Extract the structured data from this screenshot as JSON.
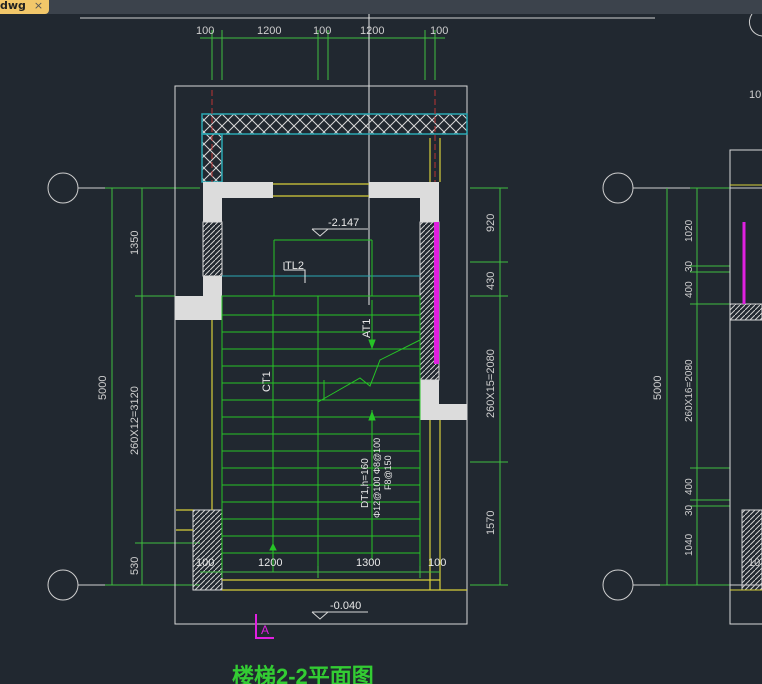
{
  "tab": {
    "label": "dwg",
    "close": "×"
  },
  "drawing": {
    "title": "楼梯2-2平面图",
    "section_mark": "A",
    "levels": {
      "upper": "-2.147",
      "lower": "-0.040"
    },
    "top_dims": [
      "100",
      "1200",
      "100",
      "1200",
      "100"
    ],
    "bottom_dims": [
      "100",
      "1200",
      "1300",
      "100"
    ],
    "left_dims": {
      "total": "5000",
      "upper": "1350",
      "middle": "260X12=3120",
      "lower": "530"
    },
    "right_dims": {
      "d1": "920",
      "d2": "430",
      "d3": "260X15=2080",
      "d4": "1570"
    },
    "labels": {
      "tl": "TL2",
      "ct": "CT1",
      "at": "AT1",
      "beam": "DT1,h=160",
      "beam_reinf1": "Φ12@100 Φ8@100",
      "beam_reinf2": "F8@150"
    },
    "right_partial": {
      "top_dim": "10",
      "total": "5000",
      "dims": [
        "1020",
        "30",
        "400",
        "260X16=2080",
        "400",
        "30",
        "1040"
      ],
      "corner": "10"
    }
  },
  "colors": {
    "background": "#212830",
    "dim": "#3fbe3f",
    "wall": "#dcdcdc",
    "hatch": "#2aa7b3",
    "stair": "#26c426",
    "yellow": "#d8cf3a",
    "magenta": "#e020e0",
    "title": "#33cc33"
  }
}
